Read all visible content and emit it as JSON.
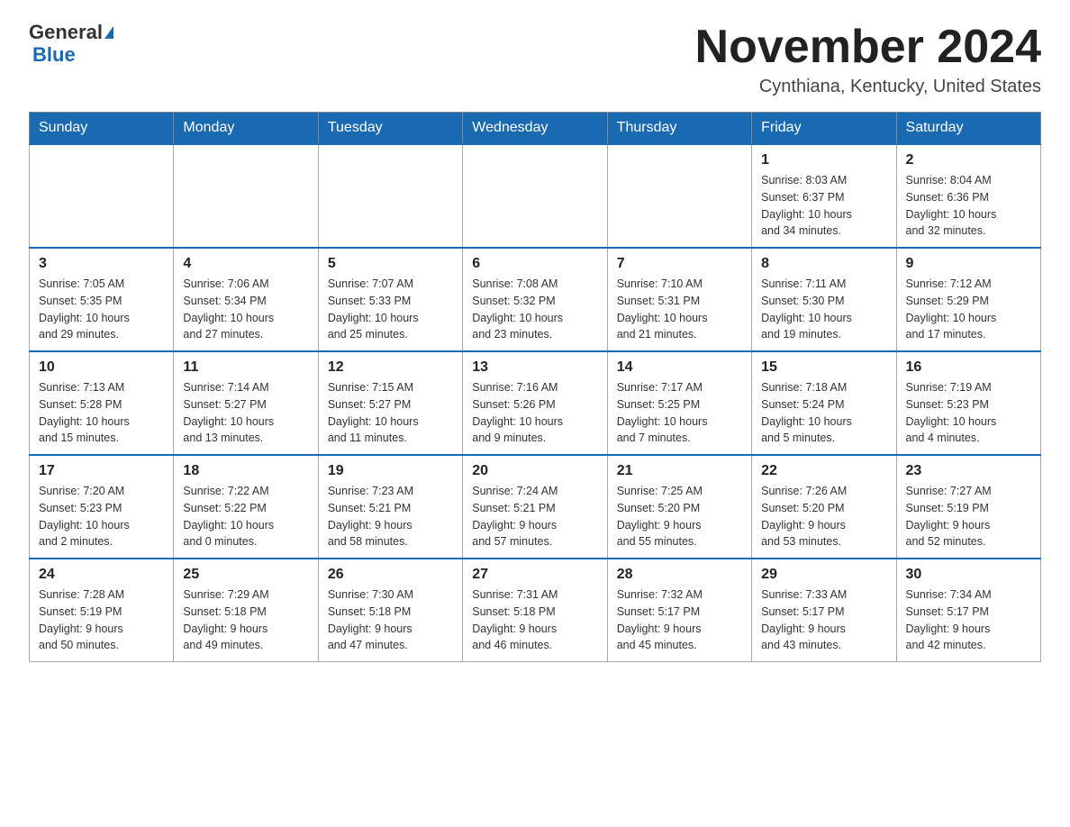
{
  "logo": {
    "general": "General",
    "blue": "Blue"
  },
  "header": {
    "month_title": "November 2024",
    "location": "Cynthiana, Kentucky, United States"
  },
  "days_of_week": [
    "Sunday",
    "Monday",
    "Tuesday",
    "Wednesday",
    "Thursday",
    "Friday",
    "Saturday"
  ],
  "weeks": [
    [
      {
        "day": "",
        "info": ""
      },
      {
        "day": "",
        "info": ""
      },
      {
        "day": "",
        "info": ""
      },
      {
        "day": "",
        "info": ""
      },
      {
        "day": "",
        "info": ""
      },
      {
        "day": "1",
        "info": "Sunrise: 8:03 AM\nSunset: 6:37 PM\nDaylight: 10 hours\nand 34 minutes."
      },
      {
        "day": "2",
        "info": "Sunrise: 8:04 AM\nSunset: 6:36 PM\nDaylight: 10 hours\nand 32 minutes."
      }
    ],
    [
      {
        "day": "3",
        "info": "Sunrise: 7:05 AM\nSunset: 5:35 PM\nDaylight: 10 hours\nand 29 minutes."
      },
      {
        "day": "4",
        "info": "Sunrise: 7:06 AM\nSunset: 5:34 PM\nDaylight: 10 hours\nand 27 minutes."
      },
      {
        "day": "5",
        "info": "Sunrise: 7:07 AM\nSunset: 5:33 PM\nDaylight: 10 hours\nand 25 minutes."
      },
      {
        "day": "6",
        "info": "Sunrise: 7:08 AM\nSunset: 5:32 PM\nDaylight: 10 hours\nand 23 minutes."
      },
      {
        "day": "7",
        "info": "Sunrise: 7:10 AM\nSunset: 5:31 PM\nDaylight: 10 hours\nand 21 minutes."
      },
      {
        "day": "8",
        "info": "Sunrise: 7:11 AM\nSunset: 5:30 PM\nDaylight: 10 hours\nand 19 minutes."
      },
      {
        "day": "9",
        "info": "Sunrise: 7:12 AM\nSunset: 5:29 PM\nDaylight: 10 hours\nand 17 minutes."
      }
    ],
    [
      {
        "day": "10",
        "info": "Sunrise: 7:13 AM\nSunset: 5:28 PM\nDaylight: 10 hours\nand 15 minutes."
      },
      {
        "day": "11",
        "info": "Sunrise: 7:14 AM\nSunset: 5:27 PM\nDaylight: 10 hours\nand 13 minutes."
      },
      {
        "day": "12",
        "info": "Sunrise: 7:15 AM\nSunset: 5:27 PM\nDaylight: 10 hours\nand 11 minutes."
      },
      {
        "day": "13",
        "info": "Sunrise: 7:16 AM\nSunset: 5:26 PM\nDaylight: 10 hours\nand 9 minutes."
      },
      {
        "day": "14",
        "info": "Sunrise: 7:17 AM\nSunset: 5:25 PM\nDaylight: 10 hours\nand 7 minutes."
      },
      {
        "day": "15",
        "info": "Sunrise: 7:18 AM\nSunset: 5:24 PM\nDaylight: 10 hours\nand 5 minutes."
      },
      {
        "day": "16",
        "info": "Sunrise: 7:19 AM\nSunset: 5:23 PM\nDaylight: 10 hours\nand 4 minutes."
      }
    ],
    [
      {
        "day": "17",
        "info": "Sunrise: 7:20 AM\nSunset: 5:23 PM\nDaylight: 10 hours\nand 2 minutes."
      },
      {
        "day": "18",
        "info": "Sunrise: 7:22 AM\nSunset: 5:22 PM\nDaylight: 10 hours\nand 0 minutes."
      },
      {
        "day": "19",
        "info": "Sunrise: 7:23 AM\nSunset: 5:21 PM\nDaylight: 9 hours\nand 58 minutes."
      },
      {
        "day": "20",
        "info": "Sunrise: 7:24 AM\nSunset: 5:21 PM\nDaylight: 9 hours\nand 57 minutes."
      },
      {
        "day": "21",
        "info": "Sunrise: 7:25 AM\nSunset: 5:20 PM\nDaylight: 9 hours\nand 55 minutes."
      },
      {
        "day": "22",
        "info": "Sunrise: 7:26 AM\nSunset: 5:20 PM\nDaylight: 9 hours\nand 53 minutes."
      },
      {
        "day": "23",
        "info": "Sunrise: 7:27 AM\nSunset: 5:19 PM\nDaylight: 9 hours\nand 52 minutes."
      }
    ],
    [
      {
        "day": "24",
        "info": "Sunrise: 7:28 AM\nSunset: 5:19 PM\nDaylight: 9 hours\nand 50 minutes."
      },
      {
        "day": "25",
        "info": "Sunrise: 7:29 AM\nSunset: 5:18 PM\nDaylight: 9 hours\nand 49 minutes."
      },
      {
        "day": "26",
        "info": "Sunrise: 7:30 AM\nSunset: 5:18 PM\nDaylight: 9 hours\nand 47 minutes."
      },
      {
        "day": "27",
        "info": "Sunrise: 7:31 AM\nSunset: 5:18 PM\nDaylight: 9 hours\nand 46 minutes."
      },
      {
        "day": "28",
        "info": "Sunrise: 7:32 AM\nSunset: 5:17 PM\nDaylight: 9 hours\nand 45 minutes."
      },
      {
        "day": "29",
        "info": "Sunrise: 7:33 AM\nSunset: 5:17 PM\nDaylight: 9 hours\nand 43 minutes."
      },
      {
        "day": "30",
        "info": "Sunrise: 7:34 AM\nSunset: 5:17 PM\nDaylight: 9 hours\nand 42 minutes."
      }
    ]
  ]
}
